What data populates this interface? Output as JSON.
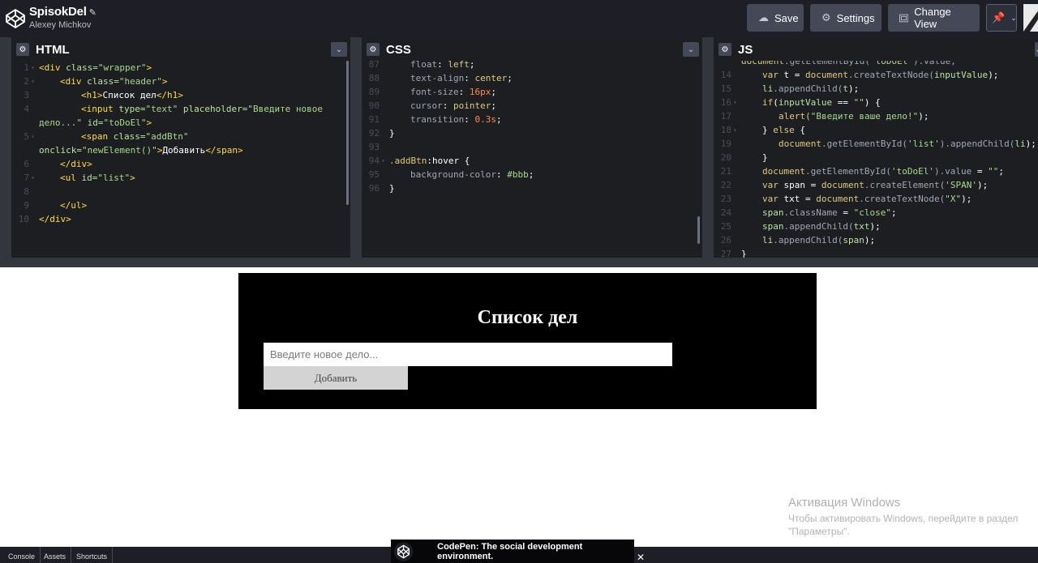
{
  "header": {
    "pen_title": "SpisokDel",
    "author": "Alexey Michkov",
    "save_label": "Save",
    "settings_label": "Settings",
    "change_view_label": "Change View"
  },
  "editors": {
    "html": {
      "title": "HTML",
      "lines": [
        {
          "n": "1",
          "fold": true
        },
        {
          "n": "2",
          "fold": true
        },
        {
          "n": "3",
          "fold": false
        },
        {
          "n": "4",
          "fold": false
        },
        {
          "n": "",
          "fold": false
        },
        {
          "n": "5",
          "fold": true
        },
        {
          "n": "",
          "fold": false
        },
        {
          "n": "6",
          "fold": false
        },
        {
          "n": "7",
          "fold": true
        },
        {
          "n": "8",
          "fold": false
        },
        {
          "n": "9",
          "fold": false
        },
        {
          "n": "10",
          "fold": false
        }
      ],
      "code": {
        "l1": [
          "<div ",
          "class=",
          "\"wrapper\"",
          ">"
        ],
        "l2": [
          "<div ",
          "class=",
          "\"header\"",
          ">"
        ],
        "l3": [
          "<h1>",
          "Список дел",
          "</h1>"
        ],
        "l4": [
          "<input ",
          "type=",
          "\"text\" ",
          "placeholder=",
          "\"Введите новое"
        ],
        "l4b": [
          "дело...\" ",
          "id=",
          "\"toDoEl\"",
          ">"
        ],
        "l5": [
          "<span ",
          "class=",
          "\"addBtn\""
        ],
        "l5b": [
          "onclick=",
          "\"newElement()\"",
          ">",
          "Добавить",
          "</span>"
        ],
        "l6": [
          "</div>"
        ],
        "l7": [
          "<ul ",
          "id=",
          "\"list\"",
          ">"
        ],
        "l8": [
          ""
        ],
        "l9": [
          "</ul>"
        ],
        "l10": [
          "</div>"
        ]
      }
    },
    "css": {
      "title": "CSS",
      "lines": [
        {
          "n": "87",
          "fold": false
        },
        {
          "n": "88",
          "fold": false
        },
        {
          "n": "89",
          "fold": false
        },
        {
          "n": "90",
          "fold": false
        },
        {
          "n": "91",
          "fold": false
        },
        {
          "n": "92",
          "fold": false
        },
        {
          "n": "93",
          "fold": false
        },
        {
          "n": "94",
          "fold": true
        },
        {
          "n": "95",
          "fold": false
        },
        {
          "n": "96",
          "fold": false
        }
      ],
      "code": {
        "l87": [
          "float",
          ": ",
          "left",
          ";"
        ],
        "l88": [
          "text-align",
          ": ",
          "center",
          ";"
        ],
        "l89": [
          "font-size",
          ": ",
          "16px",
          ";"
        ],
        "l90": [
          "cursor",
          ": ",
          "pointer",
          ";"
        ],
        "l91": [
          "transition",
          ": ",
          "0.3s",
          ";"
        ],
        "l92": [
          "}"
        ],
        "l93": [
          ""
        ],
        "l94": [
          ".addBtn",
          ":hover",
          " {"
        ],
        "l95": [
          "background-color",
          ": ",
          "#bbb",
          ";"
        ],
        "l96": [
          "}"
        ]
      }
    },
    "js": {
      "title": "JS",
      "lines": [
        {
          "n": "",
          "fold": false
        },
        {
          "n": "14",
          "fold": false
        },
        {
          "n": "15",
          "fold": false
        },
        {
          "n": "16",
          "fold": true
        },
        {
          "n": "17",
          "fold": false
        },
        {
          "n": "18",
          "fold": true
        },
        {
          "n": "19",
          "fold": false
        },
        {
          "n": "20",
          "fold": false
        },
        {
          "n": "21",
          "fold": false
        },
        {
          "n": "22",
          "fold": false
        },
        {
          "n": "23",
          "fold": false
        },
        {
          "n": "24",
          "fold": false
        },
        {
          "n": "25",
          "fold": false
        },
        {
          "n": "26",
          "fold": false
        },
        {
          "n": "27",
          "fold": false
        }
      ],
      "code": {
        "l13": [
          "document",
          ".getElementById(",
          "'toDoEl'",
          ").value;"
        ],
        "l14": [
          "var ",
          "t ",
          "= ",
          "document",
          ".createTextNode(",
          "inputValue",
          ");"
        ],
        "l15": [
          "li",
          ".appendChild(",
          "t",
          ");"
        ],
        "l16": [
          "if",
          "(",
          "inputValue ",
          "== ",
          "\"\"",
          ") {"
        ],
        "l17": [
          "alert(",
          "\"Введите ваше дело!\"",
          ");"
        ],
        "l18": [
          "} ",
          "else ",
          "{"
        ],
        "l19": [
          "document",
          ".getElementById(",
          "'list'",
          ").appendChild(",
          "li",
          ");"
        ],
        "l20": [
          "}"
        ],
        "l21": [
          "document",
          ".getElementById(",
          "'toDoEl'",
          ").value ",
          "= ",
          "\"\"",
          ";"
        ],
        "l22": [
          "var ",
          "span ",
          "= ",
          "document",
          ".createElement(",
          "'SPAN'",
          ");"
        ],
        "l23": [
          "var ",
          "txt ",
          "= ",
          "document",
          ".createTextNode(",
          "\"X\"",
          ");"
        ],
        "l24": [
          "span",
          ".className ",
          "= ",
          "\"close\"",
          ";"
        ],
        "l25": [
          "span",
          ".appendChild(",
          "txt",
          ");"
        ],
        "l26": [
          "li",
          ".appendChild(",
          "span",
          ");"
        ],
        "l27": [
          "}"
        ]
      }
    }
  },
  "preview": {
    "heading": "Список дел",
    "input_placeholder": "Введите новое дело...",
    "add_button": "Добавить"
  },
  "watermark": {
    "title": "Активация Windows",
    "line1": "Чтобы активировать Windows, перейдите в раздел",
    "line2": "\"Параметры\"."
  },
  "footer": {
    "tabs": [
      "Console",
      "Assets",
      "Shortcuts"
    ],
    "popup_text": "CodePen: The social development environment.",
    "close_label": "✕"
  },
  "colors": {
    "chrome_bg": "#1e1f26",
    "editor_bg": "#1d1e22",
    "button_bg": "#444857",
    "tag": "#ffdd40",
    "attribute": "#b8e3a0",
    "string": "#a8d98a",
    "number": "#ff8a47"
  }
}
